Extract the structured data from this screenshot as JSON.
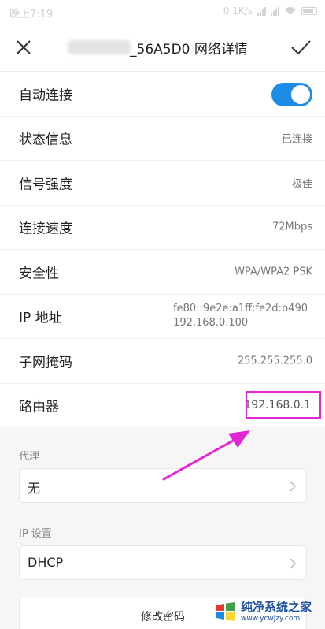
{
  "status_bar": {
    "time": "晚上7:19",
    "speed": "0.1K/s"
  },
  "title_bar": {
    "network_name_suffix": "_56A5D0",
    "title": "网络详情",
    "close_icon": "close-icon",
    "confirm_icon": "check-icon"
  },
  "settings": {
    "auto_connect": {
      "label": "自动连接",
      "enabled": true
    },
    "status": {
      "label": "状态信息",
      "value": "已连接"
    },
    "signal": {
      "label": "信号强度",
      "value": "极佳"
    },
    "speed": {
      "label": "连接速度",
      "value": "72Mbps"
    },
    "security": {
      "label": "安全性",
      "value": "WPA/WPA2 PSK"
    },
    "ip": {
      "label": "IP 地址",
      "value_ipv6": "fe80::9e2e:a1ff:fe2d:b490",
      "value_ipv4": "192.168.0.100"
    },
    "subnet": {
      "label": "子网掩码",
      "value": "255.255.255.0"
    },
    "router": {
      "label": "路由器",
      "value": "192.168.0.1"
    }
  },
  "proxy": {
    "section_label": "代理",
    "selected": "无"
  },
  "ip_settings": {
    "section_label": "IP 设置",
    "selected": "DHCP"
  },
  "change_password_button": "修改密码",
  "watermark": {
    "title": "纯净系统之家",
    "url": "www.ycwjzy.com"
  },
  "colors": {
    "toggle_on": "#1e8ce6",
    "highlight": "#e326d4",
    "watermark": "#1b4fa0"
  }
}
